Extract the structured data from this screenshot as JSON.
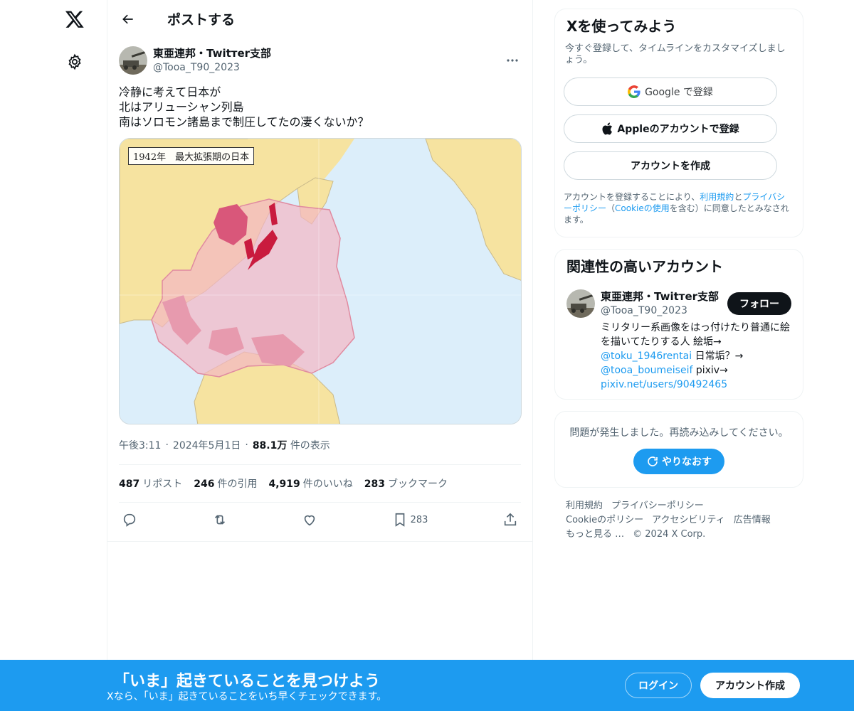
{
  "header": {
    "title": "ポストする"
  },
  "tweet": {
    "author_name": "東亜連邦・Twitтer支部",
    "author_handle": "@Tooa_T90_2023",
    "text_lines": [
      "冷静に考えて日本が",
      "北はアリューシャン列島",
      "南はソロモン諸島まで制圧してたの凄くないか？"
    ],
    "media_caption": "1942年　最大拡張期の日本",
    "time": "午後3:11",
    "date": "2024年5月1日",
    "views_value": "88.1万",
    "views_label": "件の表示",
    "stats": {
      "reposts_value": "487",
      "reposts_label": "リポスト",
      "quotes_value": "246",
      "quotes_label": "件の引用",
      "likes_value": "4,919",
      "likes_label": "件のいいね",
      "bookmarks_value": "283",
      "bookmarks_label": "ブックマーク"
    },
    "bookmark_count": "283"
  },
  "signup": {
    "title": "Xを使ってみよう",
    "subtitle": "今すぐ登録して、タイムラインをカスタマイズしましょう。",
    "google_label": "Google で登録",
    "apple_label": "Appleのアカウントで登録",
    "create_label": "アカウントを作成",
    "legal_prefix": "アカウントを登録することにより、",
    "legal_terms": "利用規約",
    "legal_and": "と",
    "legal_privacy": "プライバシーポリシー",
    "legal_open": "（",
    "legal_cookie": "Cookieの使用",
    "legal_suffix": "を含む）に同意したとみなされます。"
  },
  "related": {
    "title": "関連性の高いアカウント",
    "name": "東亜連邦・Twitтer支部",
    "handle": "@Tooa_T90_2023",
    "follow_label": "フォロー",
    "bio_1": "ミリタリー系画像をはっ付けたり普通に絵を描いてたりする人 絵垢→",
    "bio_link1": "@toku_1946rentai",
    "bio_2": " 日常垢？→",
    "bio_link2": "@tooa_boumeiseif",
    "bio_3": " pixiv→",
    "bio_link3": "pixiv.net/users/90492465"
  },
  "error": {
    "text": "問題が発生しました。再読み込みしてください。",
    "retry_label": "やりなおす"
  },
  "footer": {
    "links_row1": [
      "利用規約",
      "プライバシーポリシー"
    ],
    "links_row2": [
      "Cookieのポリシー",
      "アクセシビリティ",
      "広告情報"
    ],
    "more": "もっと見る …",
    "copyright": "© 2024 X Corp."
  },
  "bottom_bar": {
    "title": "「いま」起きていることを見つけよう",
    "subtitle": "Xなら、「いま」起きていることをいち早くチェックできます。",
    "login_label": "ログイン",
    "create_label": "アカウント作成"
  },
  "colors": {
    "accent": "#1d9bf0",
    "text": "#0f1419",
    "muted": "#536471"
  },
  "icons": [
    "x-logo-icon",
    "gear-icon",
    "back-arrow-icon",
    "more-icon",
    "reply-icon",
    "repost-icon",
    "like-icon",
    "bookmark-icon",
    "share-icon",
    "google-icon",
    "apple-icon",
    "refresh-icon"
  ]
}
